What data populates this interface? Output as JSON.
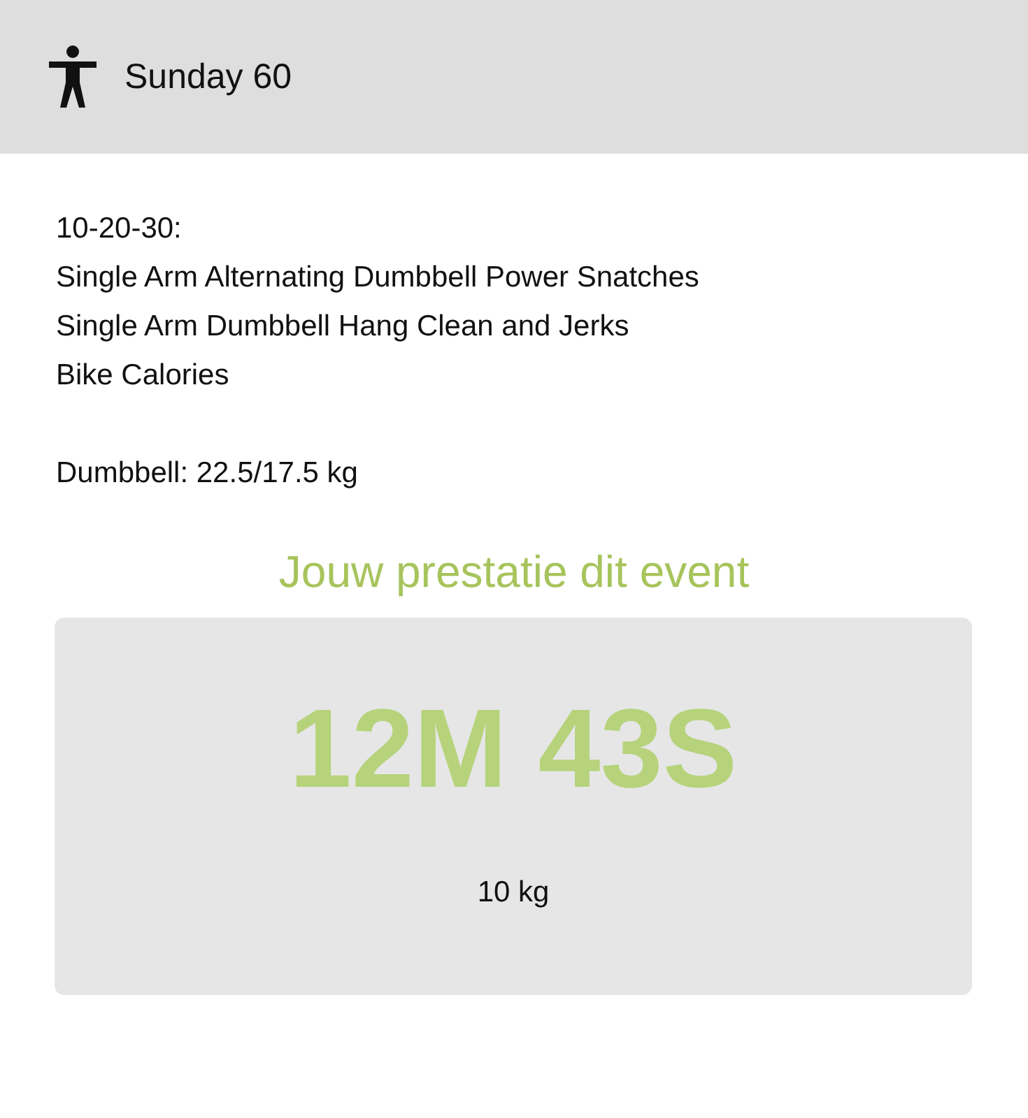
{
  "header": {
    "title": "Sunday 60"
  },
  "description": [
    {
      "lines": [
        "10-20-30:",
        "Single Arm Alternating Dumbbell Power Snatches",
        "Single Arm Dumbbell Hang Clean and Jerks",
        "Bike Calories"
      ]
    },
    {
      "lines": [
        "Dumbbell: 22.5/17.5 kg"
      ]
    }
  ],
  "result": {
    "heading": "Jouw prestatie dit event",
    "score": "12M 43S",
    "detail": "10 kg"
  }
}
